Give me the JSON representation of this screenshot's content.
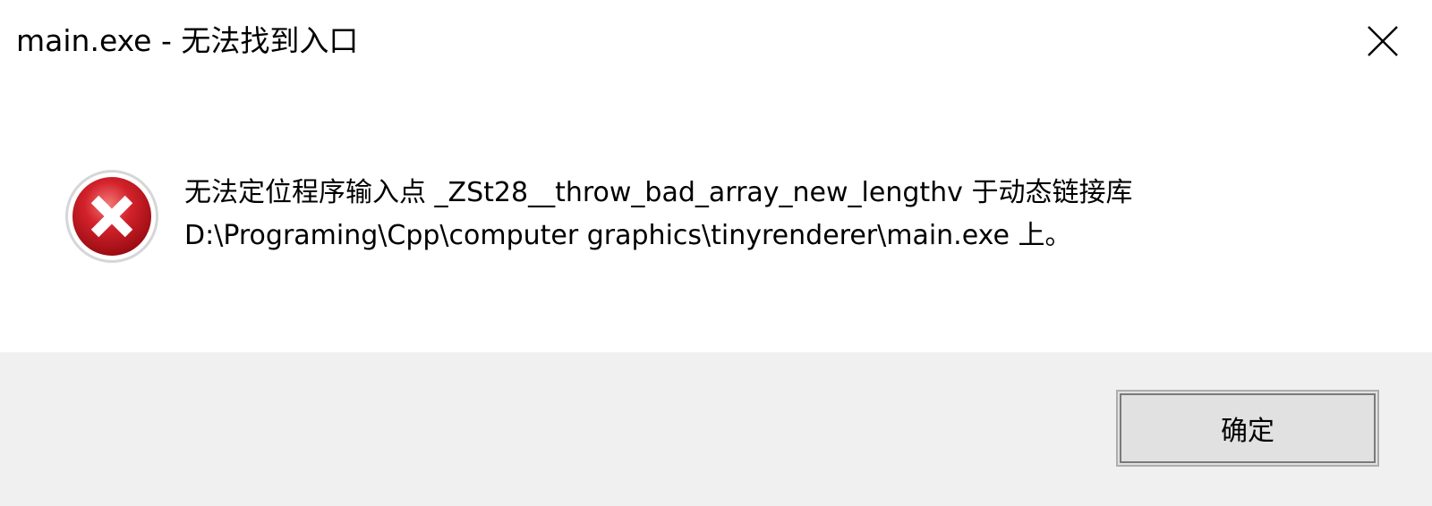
{
  "window": {
    "title": "main.exe - 无法找到入口",
    "close_icon": "close-icon"
  },
  "message": {
    "icon": "error-icon",
    "line1": "无法定位程序输入点 _ZSt28__throw_bad_array_new_lengthv 于动态链接库",
    "line2": "D:\\Programing\\Cpp\\computer graphics\\tinyrenderer\\main.exe 上。"
  },
  "buttons": {
    "ok_label": "确定"
  },
  "colors": {
    "icon_red": "#c0141d",
    "footer_bg": "#f0f0f0",
    "button_bg": "#e1e1e1"
  }
}
